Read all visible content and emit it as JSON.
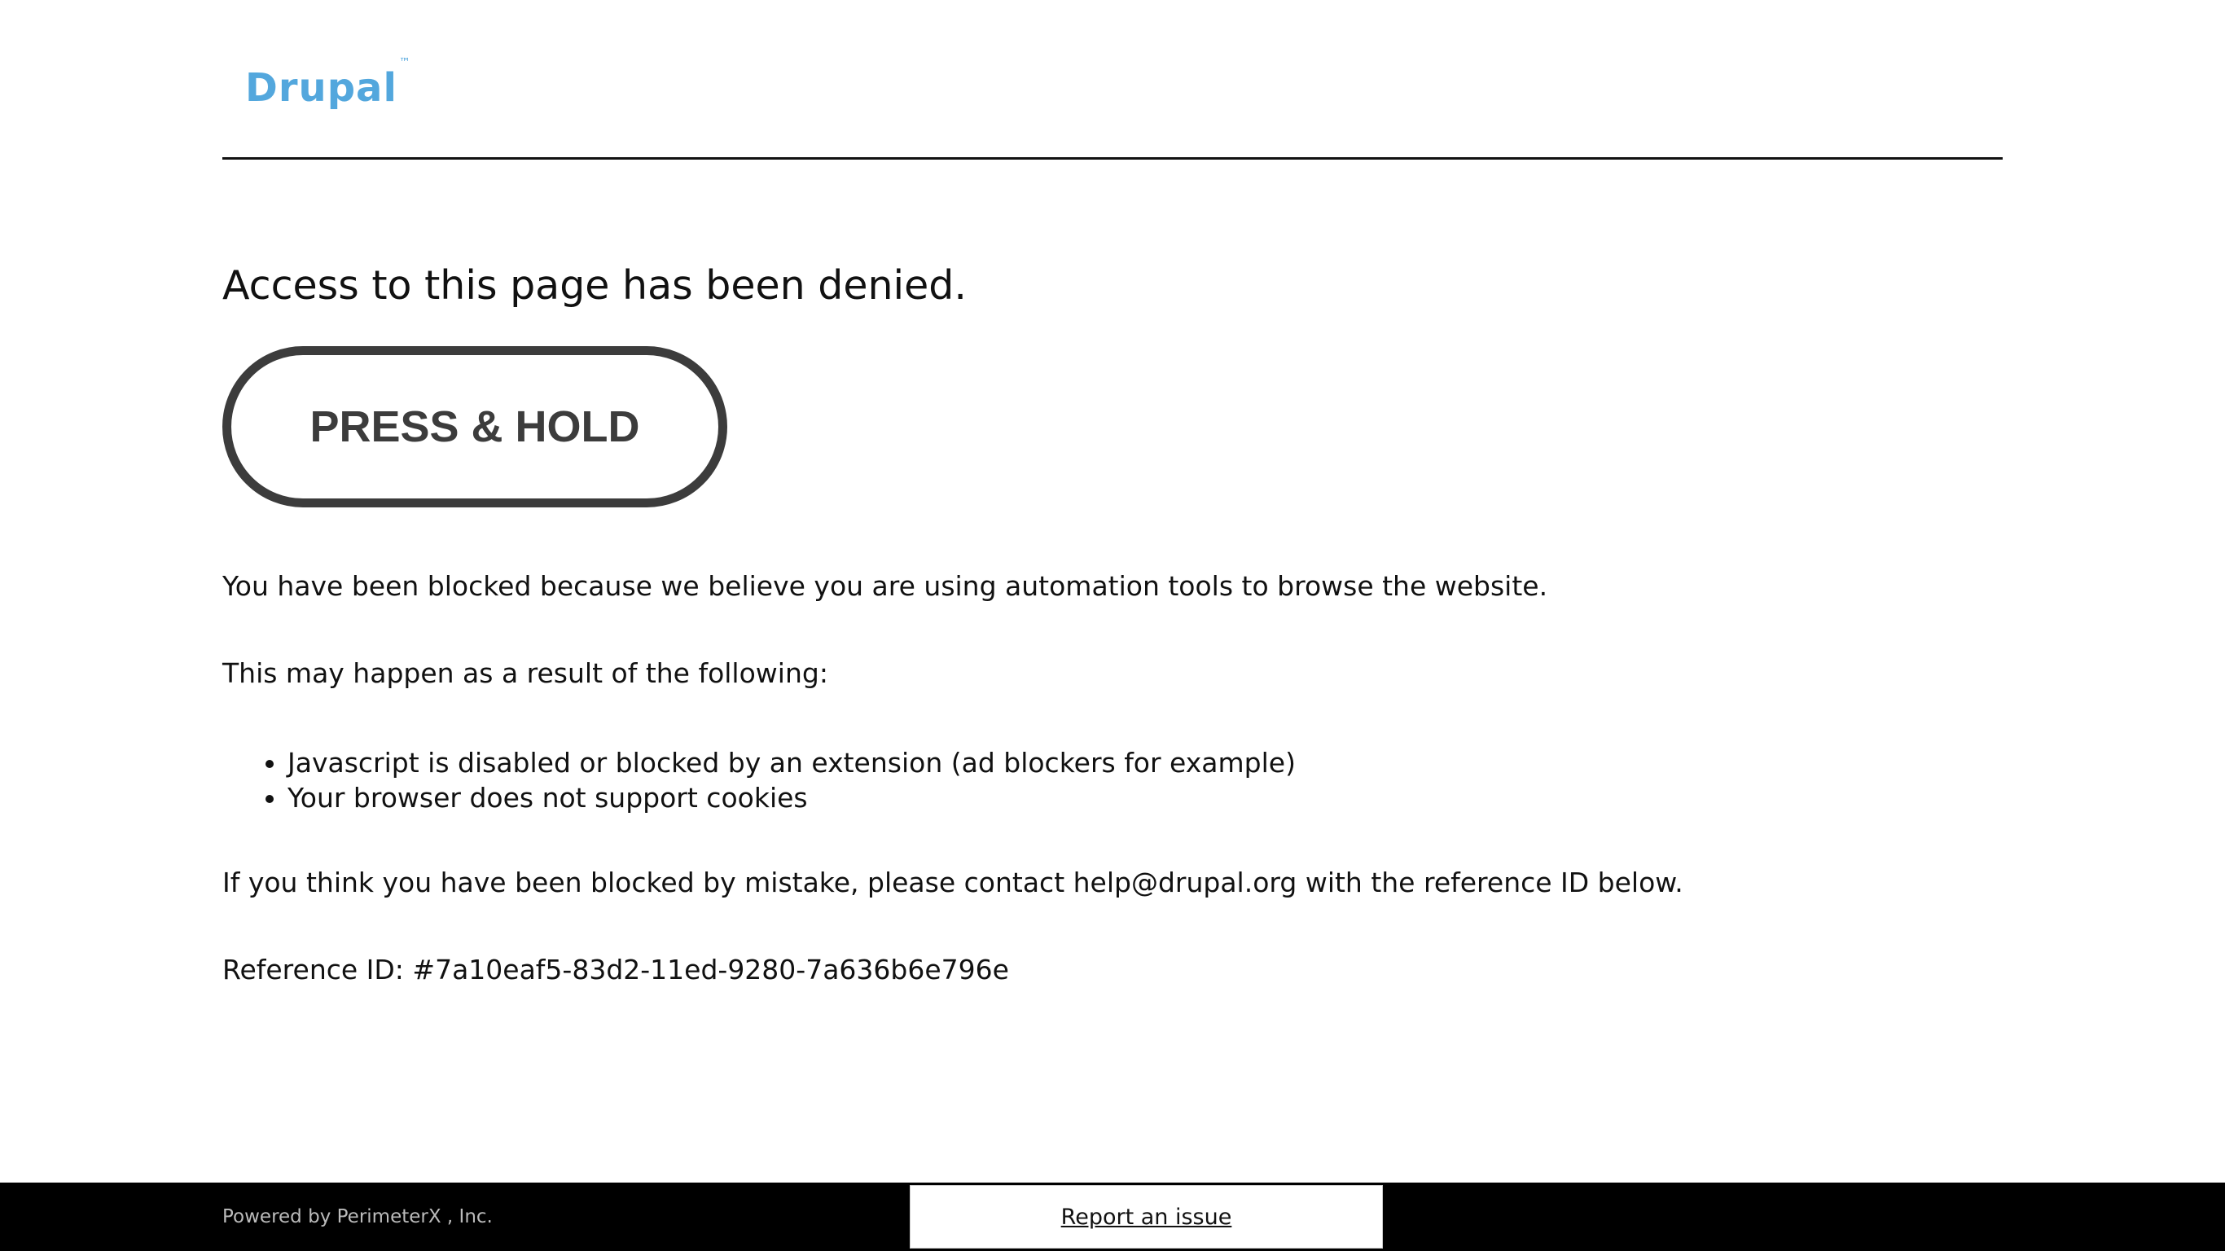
{
  "header": {
    "logo_text": "Drupal",
    "logo_trademark": "™",
    "logo_color": "#53a7dd"
  },
  "main": {
    "title": "Access to this page has been denied.",
    "hold_button_label": "PRESS & HOLD",
    "blocked_message": "You have been blocked because we believe you are using automation tools to browse the website.",
    "causes_intro": "This may happen as a result of the following:",
    "causes": [
      "Javascript is disabled or blocked by an extension (ad blockers for example)",
      "Your browser does not support cookies"
    ],
    "contact_message": "If you think you have been blocked by mistake, please contact help@drupal.org with the reference ID below.",
    "reference_id": "Reference ID: #7a10eaf5-83d2-11ed-9280-7a636b6e796e"
  },
  "footer": {
    "powered_by": "Powered by PerimeterX , Inc.",
    "report_label": "Report an issue"
  }
}
